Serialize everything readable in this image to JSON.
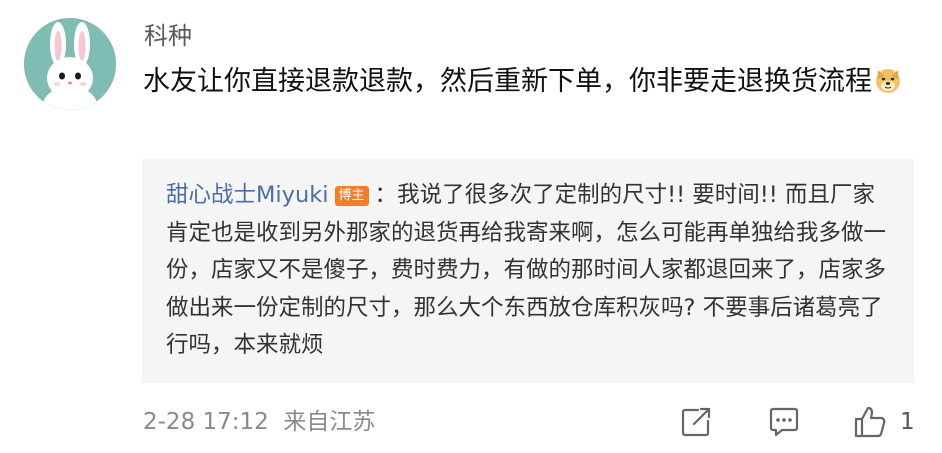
{
  "comment": {
    "username": "科种",
    "text": "水友让你直接退款退款，然后重新下单，你非要走退换货流程",
    "emoji": "doge-emoji"
  },
  "reply": {
    "author": "甜心战士Miyuki",
    "badge": "博主",
    "separator": "：",
    "text": "我说了很多次了定制的尺寸!! 要时间!! 而且厂家肯定也是收到另外那家的退货再给我寄来啊，怎么可能再单独给我多做一份，店家又不是傻子，费时费力，有做的那时间人家都退回来了，店家多做出来一份定制的尺寸，那么大个东西放仓库积灰吗? 不要事后诸葛亮了行吗，本来就烦"
  },
  "meta": {
    "timestamp": "2-28 17:12",
    "location": "来自江苏"
  },
  "actions": {
    "share_icon": "share-icon",
    "comment_icon": "comment-icon",
    "like_icon": "thumbs-up-icon",
    "like_count": "1"
  },
  "colors": {
    "avatar_bg": "#7fbcb3",
    "reply_bg": "#f5f5f5",
    "author_link": "#4a6fa5",
    "badge_bg": "#f27e2b",
    "meta_text": "#8a8a8a"
  }
}
